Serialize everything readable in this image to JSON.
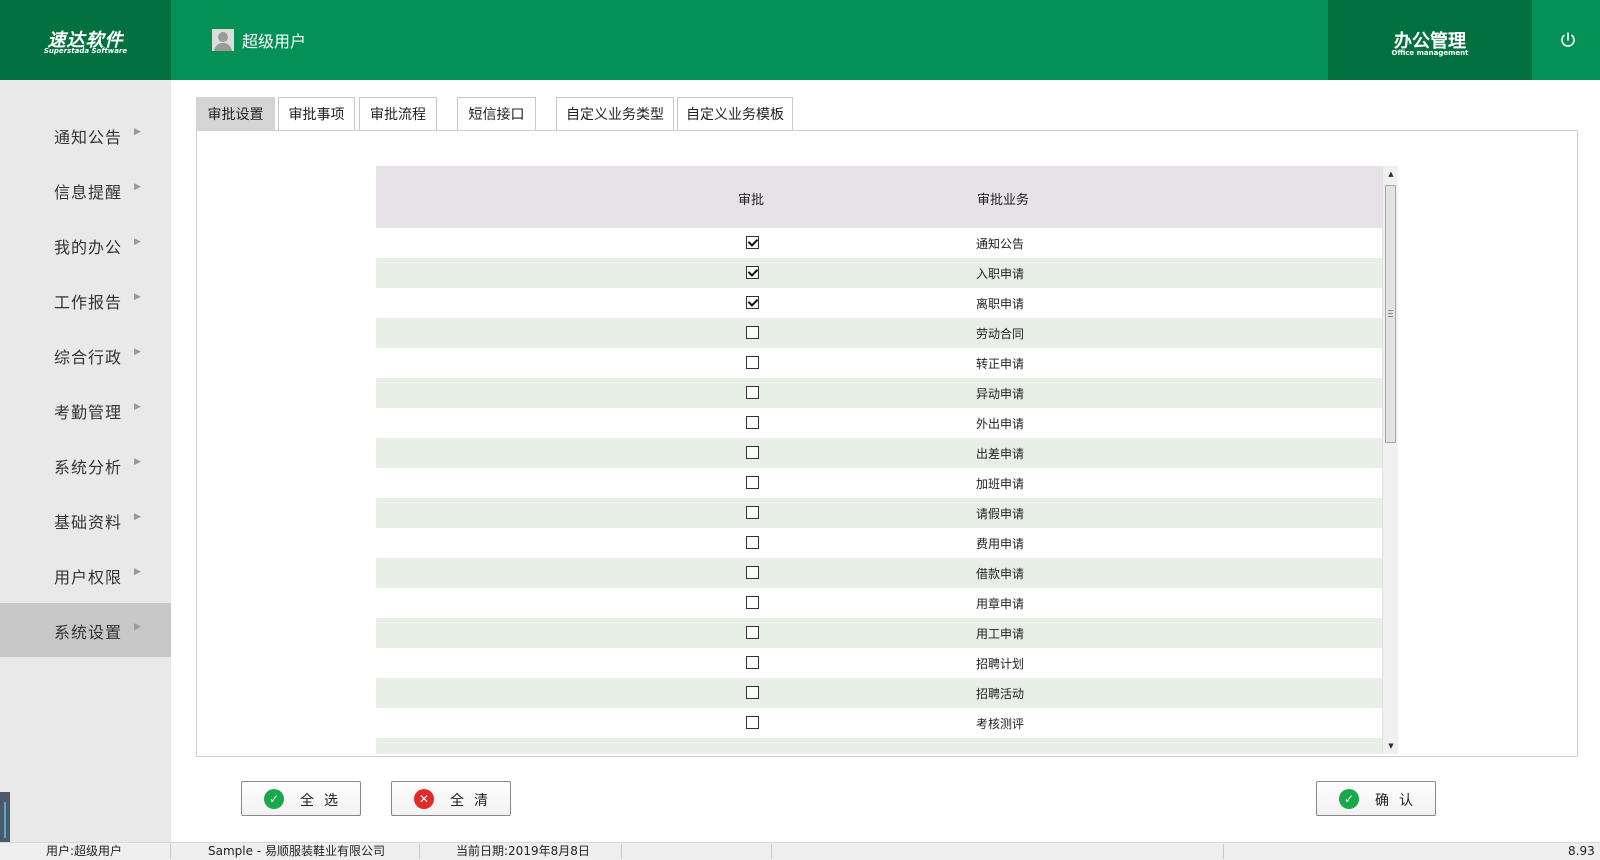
{
  "header": {
    "logo_main": "速达软件",
    "logo_sub": "Superstada Software",
    "user_name": "超级用户",
    "module_title": "办公管理",
    "module_sub": "Office management"
  },
  "sidebar": {
    "items": [
      {
        "label": "通知公告"
      },
      {
        "label": "信息提醒"
      },
      {
        "label": "我的办公"
      },
      {
        "label": "工作报告"
      },
      {
        "label": "综合行政"
      },
      {
        "label": "考勤管理"
      },
      {
        "label": "系统分析"
      },
      {
        "label": "基础资料"
      },
      {
        "label": "用户权限"
      },
      {
        "label": "系统设置"
      }
    ],
    "active_index": 9
  },
  "tabs": [
    {
      "label": "审批设置"
    },
    {
      "label": "审批事项"
    },
    {
      "label": "审批流程"
    },
    {
      "label": "短信接口"
    },
    {
      "label": "自定义业务类型"
    },
    {
      "label": "自定义业务模板"
    }
  ],
  "active_tab": 0,
  "grid": {
    "columns": [
      "审批",
      "审批业务"
    ],
    "rows": [
      {
        "checked": true,
        "name": "通知公告"
      },
      {
        "checked": true,
        "name": "入职申请"
      },
      {
        "checked": true,
        "name": "离职申请"
      },
      {
        "checked": false,
        "name": "劳动合同"
      },
      {
        "checked": false,
        "name": "转正申请"
      },
      {
        "checked": false,
        "name": "异动申请"
      },
      {
        "checked": false,
        "name": "外出申请"
      },
      {
        "checked": false,
        "name": "出差申请"
      },
      {
        "checked": false,
        "name": "加班申请"
      },
      {
        "checked": false,
        "name": "请假申请"
      },
      {
        "checked": false,
        "name": "费用申请"
      },
      {
        "checked": false,
        "name": "借款申请"
      },
      {
        "checked": false,
        "name": "用章申请"
      },
      {
        "checked": false,
        "name": "用工申请"
      },
      {
        "checked": false,
        "name": "招聘计划"
      },
      {
        "checked": false,
        "name": "招聘活动"
      },
      {
        "checked": false,
        "name": "考核测评"
      }
    ]
  },
  "buttons": {
    "select_all": "全选",
    "clear_all": "全清",
    "confirm": "确认"
  },
  "statusbar": {
    "user": "用户:超级用户",
    "company": "Sample - 易顺服装鞋业有限公司",
    "date": "当前日期:2019年8月8日",
    "version": "8.93"
  },
  "colors": {
    "header_green": "#039155",
    "header_dark_green": "#03713f",
    "sidebar_bg": "#e9e9e9",
    "sidebar_active": "#c7c7c7",
    "grid_header_bg": "#e6e2e8",
    "grid_alt_row": "#e7efe6",
    "ok_icon": "#19a84a",
    "cancel_icon": "#e02b2b"
  },
  "icons": {
    "user": "user-avatar-icon",
    "power": "power-icon",
    "nav_arrow": "triangle-right-icon",
    "ok": "check-circle-icon",
    "cancel": "x-circle-icon"
  }
}
